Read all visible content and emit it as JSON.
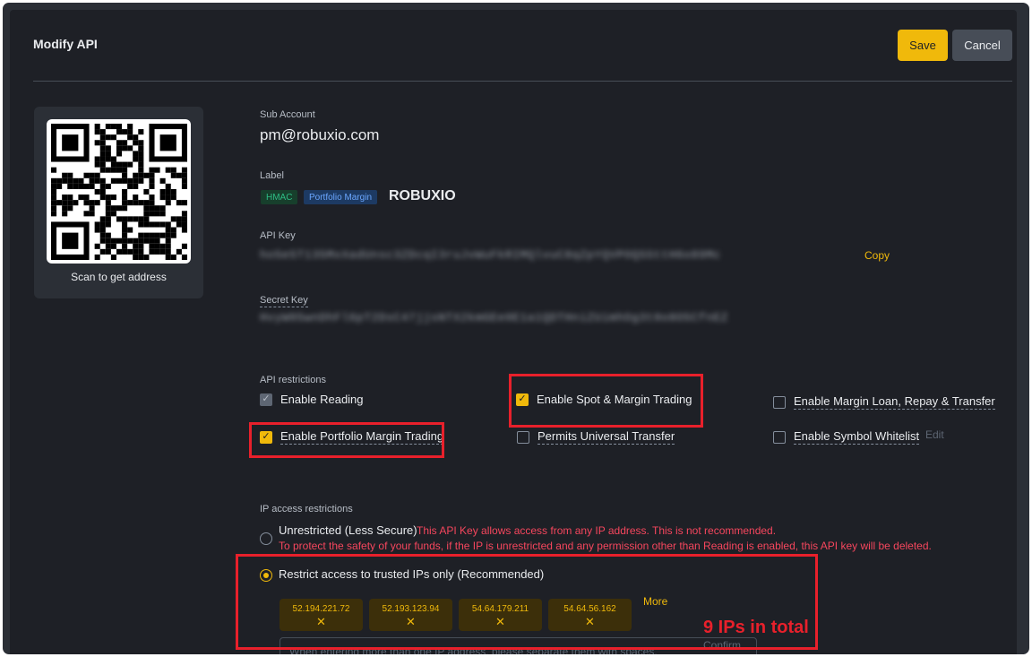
{
  "header": {
    "title": "Modify API",
    "save_label": "Save",
    "cancel_label": "Cancel"
  },
  "qr": {
    "caption": "Scan to get address"
  },
  "sub_account": {
    "label": "Sub Account",
    "value": "pm@robuxio.com"
  },
  "label_section": {
    "label": "Label",
    "tags": [
      "HMAC",
      "Portfolio Margin"
    ],
    "value": "ROBUXIO"
  },
  "api_key": {
    "label": "API Key",
    "value": "ho5e5T135MxXadUnsc3ZDcqI3ruJvWuFkRIMQlvuC8qZpYQVPOQSSttH6o89Mc",
    "copy_label": "Copy"
  },
  "secret_key": {
    "label": "Secret Key",
    "value": "HvyW05wnDhFl6pT2DsC47jjsNTX2kmGEe0E1a1QDTHniZUimhOg3t0o8O5CfnEZ"
  },
  "api_restrictions": {
    "title": "API restrictions",
    "enable_reading": "Enable Reading",
    "enable_spot_margin": "Enable Spot & Margin Trading",
    "enable_margin_loan": "Enable Margin Loan, Repay & Transfer",
    "enable_portfolio_margin": "Enable Portfolio Margin Trading",
    "permits_universal_transfer": "Permits Universal Transfer",
    "enable_symbol_whitelist": "Enable Symbol Whitelist",
    "edit_label": "Edit"
  },
  "ip_restrictions": {
    "title": "IP access restrictions",
    "unrestricted_label": "Unrestricted (Less Secure)",
    "unrestricted_warning_1": "This API Key allows access from any IP address. This is not recommended.",
    "unrestricted_warning_2": "To protect the safety of your funds, if the IP is unrestricted and any permission other than Reading is enabled, this API key will be deleted.",
    "restricted_label": "Restrict access to trusted IPs only (Recommended)",
    "ips": [
      "52.194.221.72",
      "52.193.123.94",
      "54.64.179.211",
      "54.64.56.162"
    ],
    "remove_glyph": "✕",
    "more_label": "More",
    "input_placeholder": "When entering more than one IP address, please separate them with spaces.",
    "confirm_label": "Confirm"
  },
  "annotation": {
    "text": "9 IPs in total",
    "color": "#e8202b"
  },
  "colors": {
    "accent": "#f0b90b",
    "background": "#1e2026",
    "danger": "#f6465d"
  }
}
